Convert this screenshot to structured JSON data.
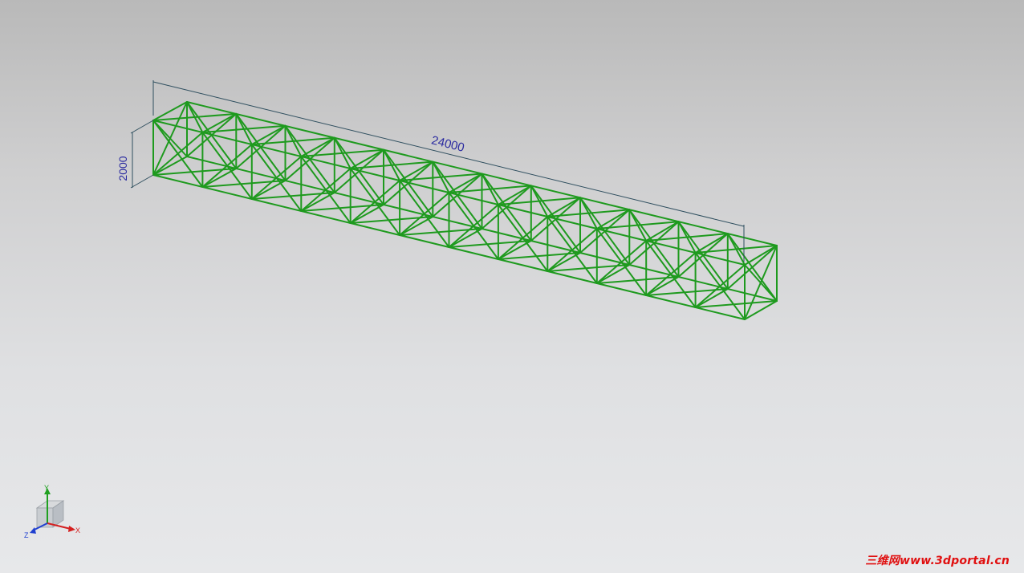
{
  "model": {
    "name": "truss",
    "bays": 12,
    "color": "#1e9a1e"
  },
  "dimensions": {
    "length_label": "24000",
    "height_label": "2000",
    "color": "#2a2aa0",
    "line_color": "#2f4f5f"
  },
  "triad": {
    "x_label": "X",
    "y_label": "Y",
    "z_label": "Z",
    "x_color": "#d42020",
    "y_color": "#20a020",
    "z_color": "#2040d0"
  },
  "watermark": {
    "text": "三维网www.3dportal.cn",
    "color": "#e01010"
  }
}
